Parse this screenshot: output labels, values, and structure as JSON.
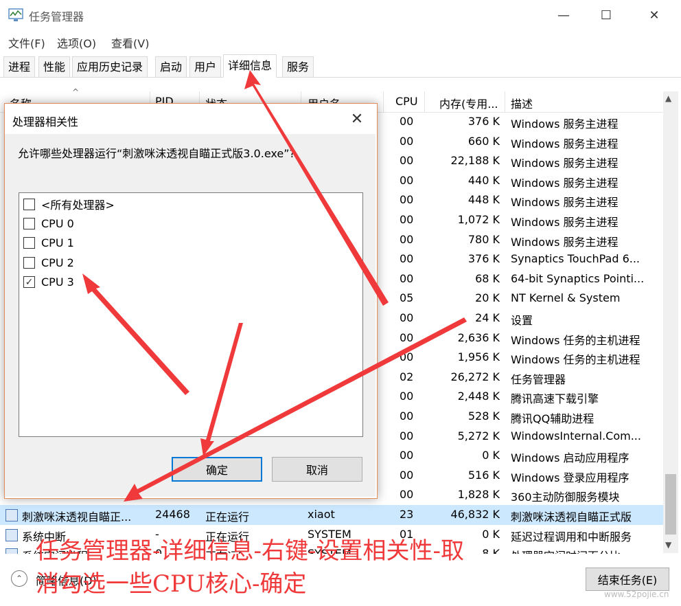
{
  "window": {
    "title": "任务管理器",
    "controls": {
      "minimize": "—",
      "maximize": "☐",
      "close": "✕"
    }
  },
  "menu": [
    "文件(F)",
    "选项(O)",
    "查看(V)"
  ],
  "tabs": [
    "进程",
    "性能",
    "应用历史记录",
    "启动",
    "用户",
    "详细信息",
    "服务"
  ],
  "table": {
    "columns": [
      "名称",
      "PID",
      "状态",
      "用户名",
      "CPU",
      "内存(专用...",
      "描述"
    ],
    "rows": [
      {
        "cpu": "00",
        "mem": "376 K",
        "desc": "Windows 服务主进程"
      },
      {
        "cpu": "00",
        "mem": "660 K",
        "desc": "Windows 服务主进程"
      },
      {
        "cpu": "00",
        "mem": "22,188 K",
        "desc": "Windows 服务主进程"
      },
      {
        "cpu": "00",
        "mem": "440 K",
        "desc": "Windows 服务主进程"
      },
      {
        "cpu": "00",
        "mem": "448 K",
        "desc": "Windows 服务主进程"
      },
      {
        "cpu": "00",
        "mem": "1,072 K",
        "desc": "Windows 服务主进程"
      },
      {
        "cpu": "00",
        "mem": "780 K",
        "desc": "Windows 服务主进程"
      },
      {
        "cpu": "00",
        "mem": "376 K",
        "desc": "Synaptics TouchPad 6..."
      },
      {
        "cpu": "00",
        "mem": "68 K",
        "desc": "64-bit Synaptics Pointi..."
      },
      {
        "cpu": "05",
        "mem": "20 K",
        "desc": "NT Kernel & System"
      },
      {
        "cpu": "00",
        "mem": "24 K",
        "desc": "设置"
      },
      {
        "cpu": "00",
        "mem": "2,636 K",
        "desc": "Windows 任务的主机进程"
      },
      {
        "cpu": "00",
        "mem": "1,956 K",
        "desc": "Windows 任务的主机进程"
      },
      {
        "cpu": "02",
        "mem": "26,272 K",
        "desc": "任务管理器"
      },
      {
        "cpu": "00",
        "mem": "2,448 K",
        "desc": "腾讯高速下载引擎"
      },
      {
        "cpu": "00",
        "mem": "528 K",
        "desc": "腾讯QQ辅助进程"
      },
      {
        "cpu": "00",
        "mem": "5,272 K",
        "desc": "WindowsInternal.Com..."
      },
      {
        "cpu": "00",
        "mem": "0 K",
        "desc": "Windows 启动应用程序"
      },
      {
        "cpu": "00",
        "mem": "516 K",
        "desc": "Windows 登录应用程序"
      },
      {
        "cpu": "00",
        "mem": "1,828 K",
        "desc": "360主动防御服务模块"
      },
      {
        "name": "刺激咪沫透视自瞄正...",
        "pid": "24468",
        "status": "正在运行",
        "user": "xiaot",
        "cpu": "23",
        "mem": "46,832 K",
        "desc": "刺激咪沫透视自瞄正式版",
        "selected": true
      },
      {
        "name": "系统中断",
        "pid": "-",
        "status": "正在运行",
        "user": "SYSTEM",
        "cpu": "01",
        "mem": "0 K",
        "desc": "延迟过程调用和中断服务"
      },
      {
        "name": "系统空闲进程",
        "pid": "0",
        "status": "正在运行",
        "user": "SYSTEM",
        "cpu": "",
        "mem": "8 K",
        "desc": "处理器空闲时间百分比"
      }
    ]
  },
  "dialog": {
    "title": "处理器相关性",
    "question": "允许哪些处理器运行“刺激咪沫透视自瞄正式版3.0.exe”?",
    "options": [
      {
        "label": "<所有处理器>",
        "checked": false
      },
      {
        "label": "CPU 0",
        "checked": false
      },
      {
        "label": "CPU 1",
        "checked": false
      },
      {
        "label": "CPU 2",
        "checked": false
      },
      {
        "label": "CPU 3",
        "checked": true
      }
    ],
    "ok": "确定",
    "cancel": "取消"
  },
  "footer": {
    "summary": "简略信息(D)",
    "end_task": "结束任务(E)"
  },
  "annotation": {
    "line1": "任务管理器-详细信息-右键-设置相关性-取",
    "line2": "消勾选一些CPU核心-确定"
  },
  "watermark": "www.52pojie.cn",
  "colors": {
    "accent": "#0078d7",
    "annotation": "#f0393a",
    "selected_row": "#cce8ff"
  }
}
